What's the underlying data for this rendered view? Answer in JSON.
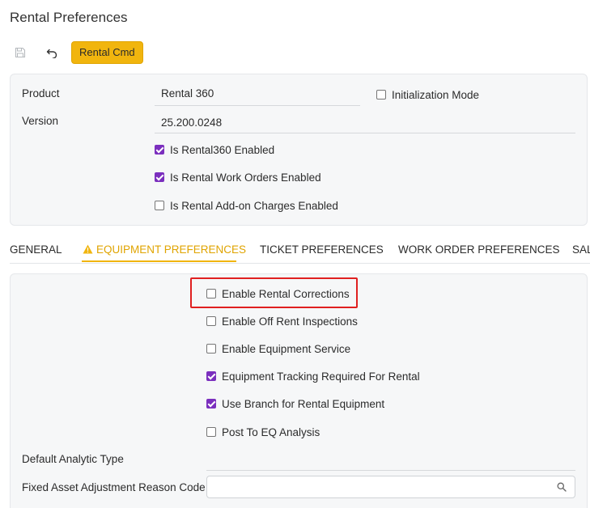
{
  "header": {
    "title": "Rental Preferences"
  },
  "toolbar": {
    "cmd_label": "Rental Cmd",
    "icons": [
      "save-icon",
      "undo-icon"
    ]
  },
  "general_info": {
    "product_label": "Product",
    "product_value": "Rental 360",
    "version_label": "Version",
    "version_value": "25.200.0248",
    "init_mode_label": "Initialization Mode",
    "init_mode_checked": false,
    "checkboxes": [
      {
        "label": "Is Rental360 Enabled",
        "checked": true
      },
      {
        "label": "Is Rental Work Orders Enabled",
        "checked": true
      },
      {
        "label": "Is Rental Add-on Charges Enabled",
        "checked": false
      }
    ]
  },
  "tabs": [
    {
      "label": "GENERAL",
      "active": false
    },
    {
      "label": "EQUIPMENT PREFERENCES",
      "active": true,
      "icon": "warning-icon"
    },
    {
      "label": "TICKET PREFERENCES",
      "active": false
    },
    {
      "label": "WORK ORDER PREFERENCES",
      "active": false
    },
    {
      "label": "SAL",
      "active": false
    }
  ],
  "equipment_prefs": {
    "checkboxes": [
      {
        "label": "Enable Rental Corrections",
        "checked": false
      },
      {
        "label": "Enable Off Rent Inspections",
        "checked": false
      },
      {
        "label": "Enable Equipment Service",
        "checked": false
      },
      {
        "label": "Equipment Tracking Required For Rental",
        "checked": true
      },
      {
        "label": "Use Branch for Rental Equipment",
        "checked": true
      },
      {
        "label": "Post To EQ Analysis",
        "checked": false
      }
    ],
    "default_analytic_type_label": "Default Analytic Type",
    "default_analytic_type_value": "",
    "fixed_asset_label": "Fixed Asset Adjustment Reason Code",
    "fixed_asset_value": "",
    "fixed_asset_placeholder": ""
  },
  "colors": {
    "accent": "#f1b50e",
    "checkbox": "#7b2fbe",
    "highlight": "#e02020"
  }
}
